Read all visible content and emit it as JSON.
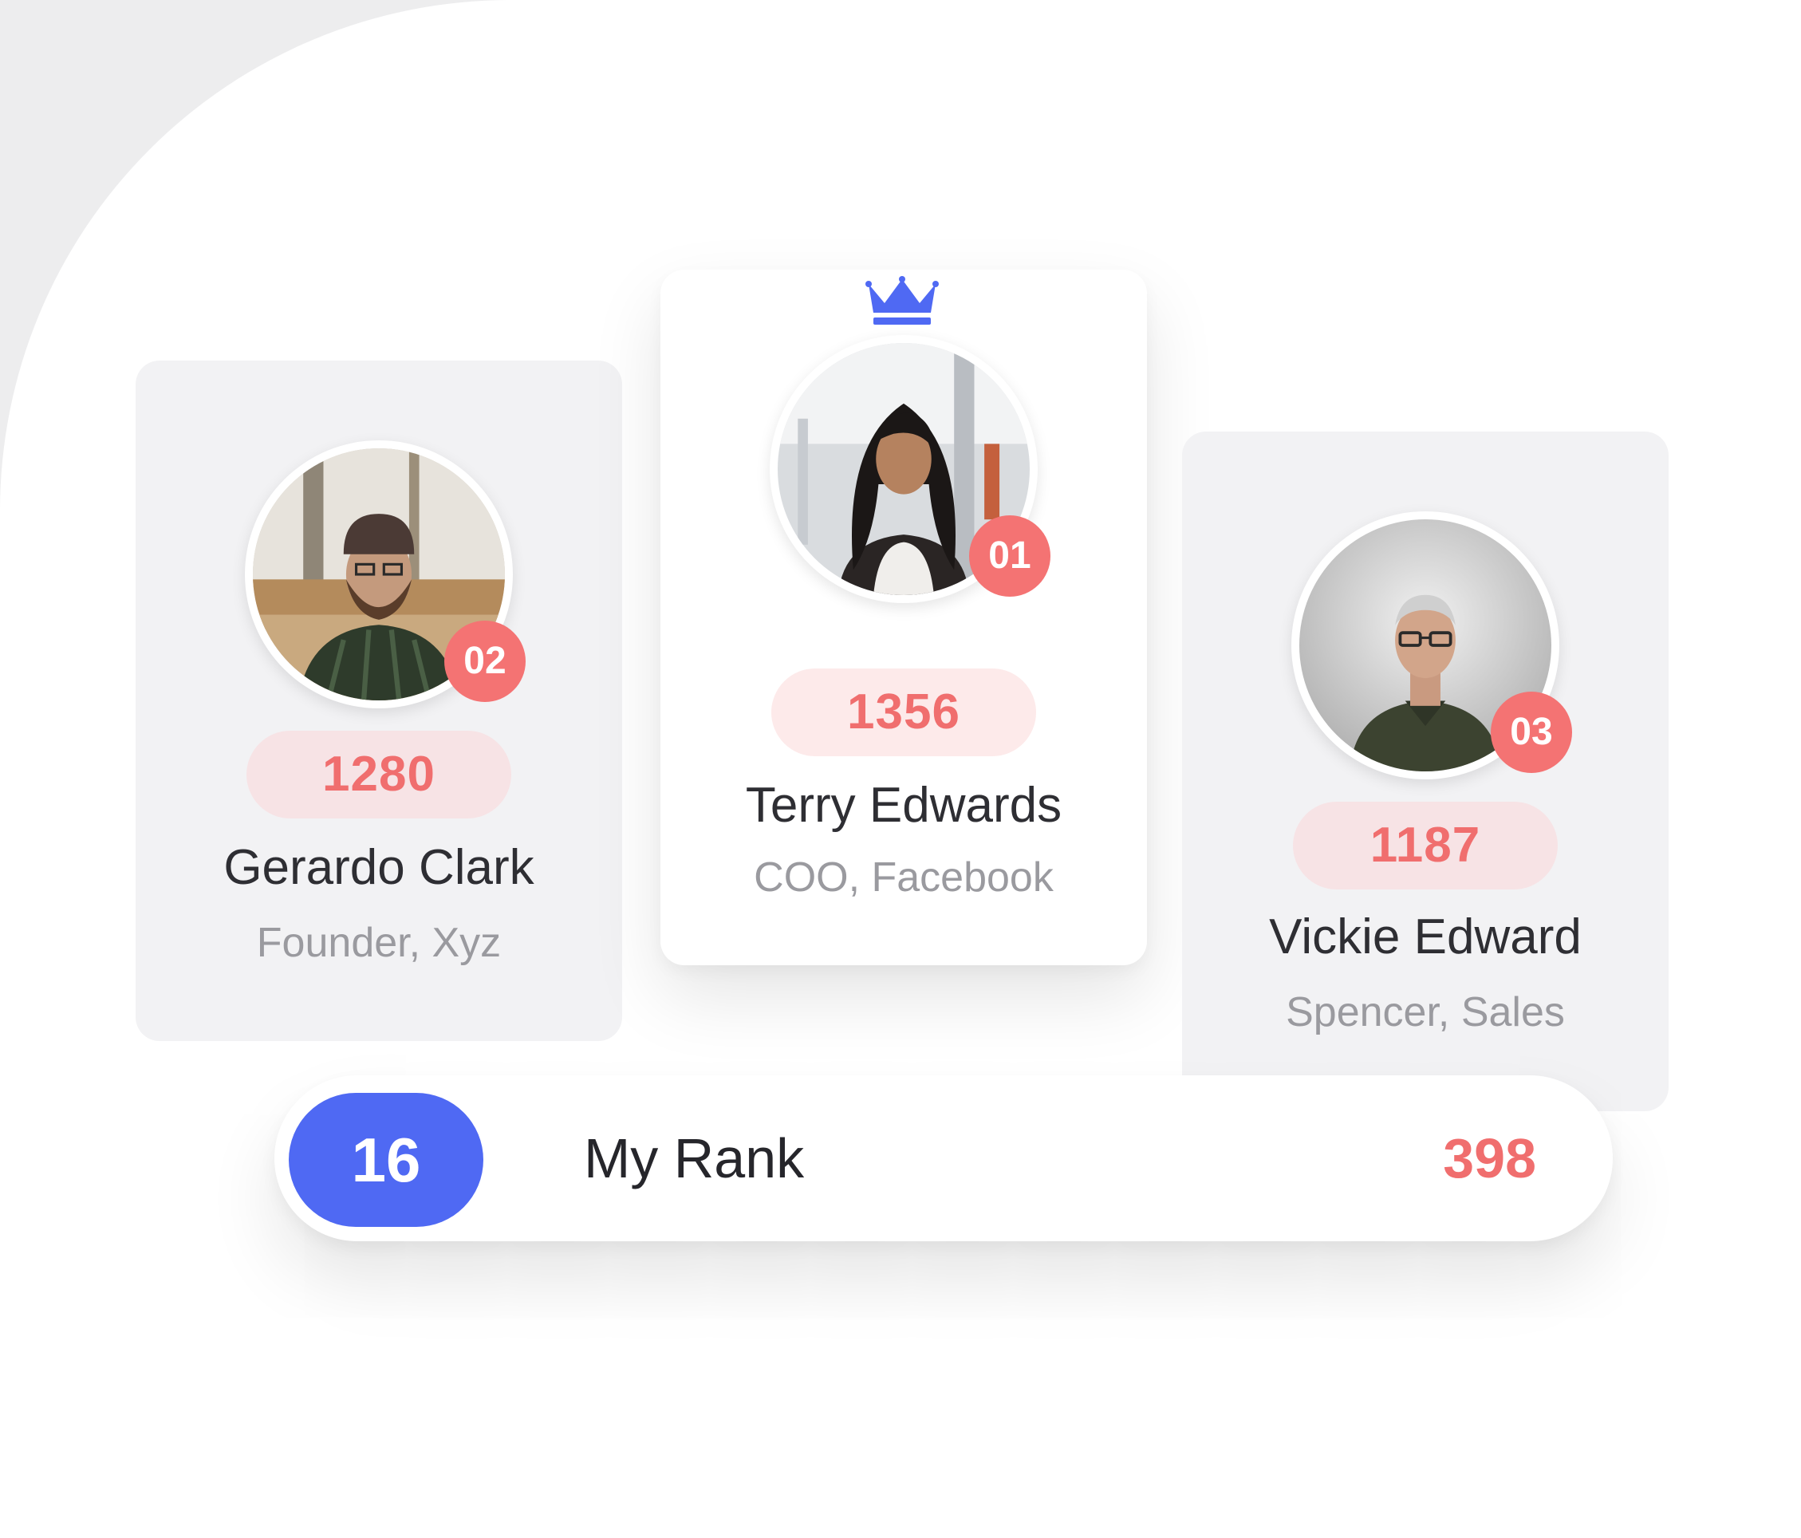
{
  "colors": {
    "accent_blue": "#4f69f3",
    "accent_red": "#f47373",
    "score_pill_bg": "#f7e3e5",
    "card_bg": "#f2f2f4"
  },
  "leaderboard": {
    "leaders": [
      {
        "position": "second",
        "rank": "02",
        "score": "1280",
        "name": "Gerardo Clark",
        "title": "Founder, Xyz",
        "avatar_icon": "person-photo-beanie"
      },
      {
        "position": "first",
        "rank": "01",
        "score": "1356",
        "name": "Terry Edwards",
        "title": "COO, Facebook",
        "avatar_icon": "person-photo-long-hair",
        "crown_icon": "crown-icon"
      },
      {
        "position": "third",
        "rank": "03",
        "score": "1187",
        "name": "Vickie Edward",
        "title": "Spencer, Sales",
        "avatar_icon": "person-photo-glasses"
      }
    ],
    "my_rank": {
      "number": "16",
      "label": "My Rank",
      "score": "398"
    }
  }
}
